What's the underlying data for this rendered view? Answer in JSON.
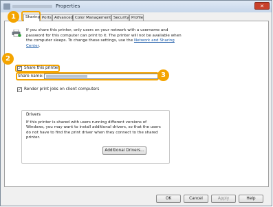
{
  "window": {
    "title": "Properties",
    "close_glyph": "✕"
  },
  "tabs": [
    "Sharing",
    "Ports",
    "Advanced",
    "Color Management",
    "Security",
    "Profile"
  ],
  "info": {
    "text": "If you share this printer, only users on your network with a username and password for this computer can print to it. The printer will not be available when the computer sleeps. To change these settings, use the ",
    "link": "Network and Sharing Center",
    "suffix": "."
  },
  "share_printer": {
    "label": "Share this printer",
    "checked": true
  },
  "share_name": {
    "label": "Share name:",
    "value": ""
  },
  "render_jobs": {
    "label": "Render print jobs on client computers",
    "checked": true
  },
  "drivers": {
    "title": "Drivers",
    "text": "If this printer is shared with users running different versions of Windows, you may want to install additional drivers, so that the users do not have to find the print driver when they connect to the shared printer.",
    "button": "Additional Drivers..."
  },
  "footer": {
    "ok": "OK",
    "cancel": "Cancel",
    "apply": "Apply",
    "help": "Help"
  },
  "callouts": [
    "1",
    "2",
    "3"
  ],
  "colors": {
    "callout": "#f4a400",
    "link": "#1a5aa8"
  },
  "icons": [
    "printer-icon",
    "share-badge-icon",
    "check-icon",
    "close-icon"
  ]
}
